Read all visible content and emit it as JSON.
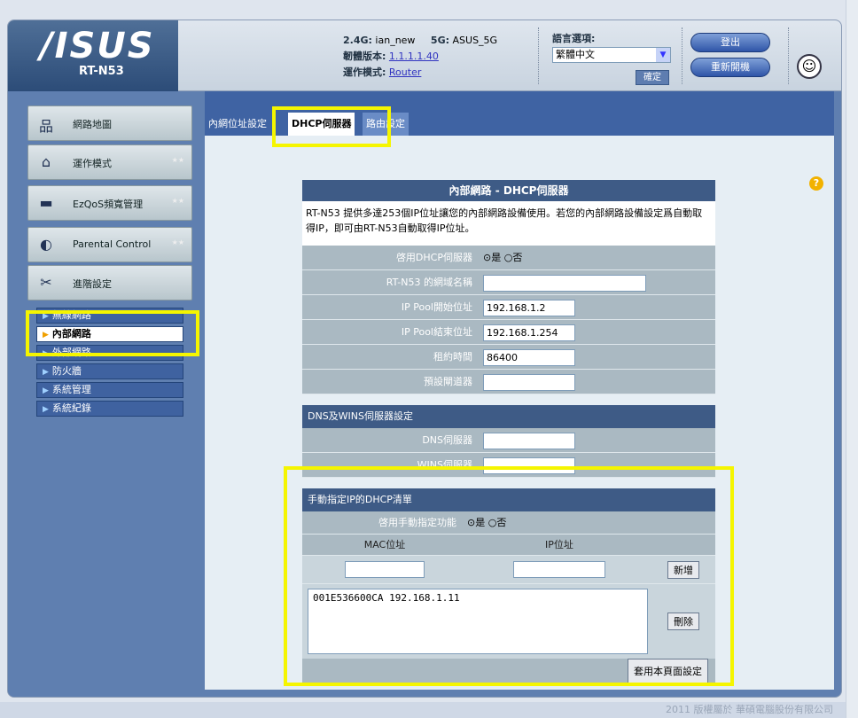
{
  "header": {
    "brand": "/ISUS",
    "model": "RT-N53",
    "ssid_24_label": "2.4G:",
    "ssid_24": "ian_new",
    "ssid_5_label": "5G:",
    "ssid_5": "ASUS_5G",
    "firmware_label": "韌體版本:",
    "firmware": "1.1.1.1.40",
    "mode_label": "運作模式:",
    "mode": "Router",
    "lang_label": "語言選項:",
    "lang_value": "繁體中文",
    "ok_button": "確定",
    "logout_button": "登出",
    "reboot_button": "重新開機"
  },
  "sidebar": {
    "items": [
      {
        "label": "網路地圖",
        "icon": "network-map-icon"
      },
      {
        "label": "運作模式",
        "icon": "router-icon"
      },
      {
        "label": "EzQoS頻寬管理",
        "icon": "qos-icon"
      },
      {
        "label": "Parental Control",
        "icon": "parental-control-icon"
      },
      {
        "label": "進階設定",
        "icon": "tools-icon"
      }
    ],
    "subitems": [
      "無線網路",
      "內部網路",
      "外部網路",
      "防火牆",
      "系統管理",
      "系統紀錄"
    ]
  },
  "tabs": [
    "內網位址設定",
    "DHCP伺服器",
    "路由設定"
  ],
  "form": {
    "title": "內部網路 - DHCP伺服器",
    "description": "RT-N53 提供多達253個IP位址讓您的內部網路設備使用。若您的內部網路設備設定爲自動取得IP，即可由RT-N53自動取得IP位址。",
    "enable_dhcp_label": "啓用DHCP伺服器",
    "yes": "是",
    "no": "否",
    "domain_label": "RT-N53 的網域名稱",
    "domain_value": "",
    "pool_start_label": "IP Pool開始位址",
    "pool_start_value": "192.168.1.2",
    "pool_end_label": "IP Pool結束位址",
    "pool_end_value": "192.168.1.254",
    "lease_label": "租約時間",
    "lease_value": "86400",
    "gateway_label": "預設閘道器",
    "gateway_value": "",
    "dns_section": "DNS及WINS伺服器設定",
    "dns_label": "DNS伺服器",
    "dns_value": "",
    "wins_label": "WINS伺服器",
    "wins_value": "",
    "manual_section": "手動指定IP的DHCP清單",
    "manual_enable_label": "啓用手動指定功能",
    "mac_header": "MAC位址",
    "ip_header": "IP位址",
    "add_button": "新增",
    "list_entry": "001E536600CA  192.168.1.11",
    "delete_button": "刪除",
    "apply_button": "套用本頁面設定"
  },
  "footer": "2011 版權屬於 華碩電腦股份有限公司"
}
